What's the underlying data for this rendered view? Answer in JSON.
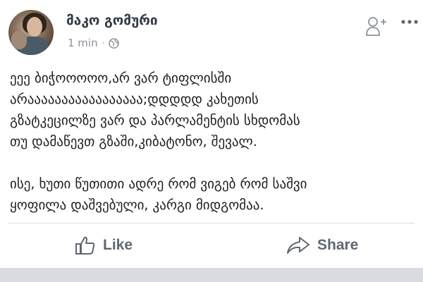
{
  "post": {
    "author": "მაკო გომური",
    "time": "1 min",
    "separator": "·",
    "privacy_icon": "globe-icon",
    "text": "ეეე ბიჭოოოოო,არ ვარ ტიფლისში\nარააააააააააააააააა;დდდდდ კახეთის\nგზატკეცილზე ვარ და პარლამენტის სხდომას\nთუ დამაწევთ გზაში,კიბატონო, შევალ.\n\nისე, ხუთი წუთითი ადრე რომ ვიგებ რომ საშვი\nყოფილა დაშვებული, კარგი მიდგომაა."
  },
  "header_actions": {
    "add_friend_icon": "add-friend-icon",
    "more_icon": "more-options-icon"
  },
  "actions": {
    "like_label": "Like",
    "share_label": "Share"
  },
  "colors": {
    "text": "#1c1e21",
    "secondary": "#606770",
    "meta": "#8c939d",
    "divider": "#dadde1"
  }
}
